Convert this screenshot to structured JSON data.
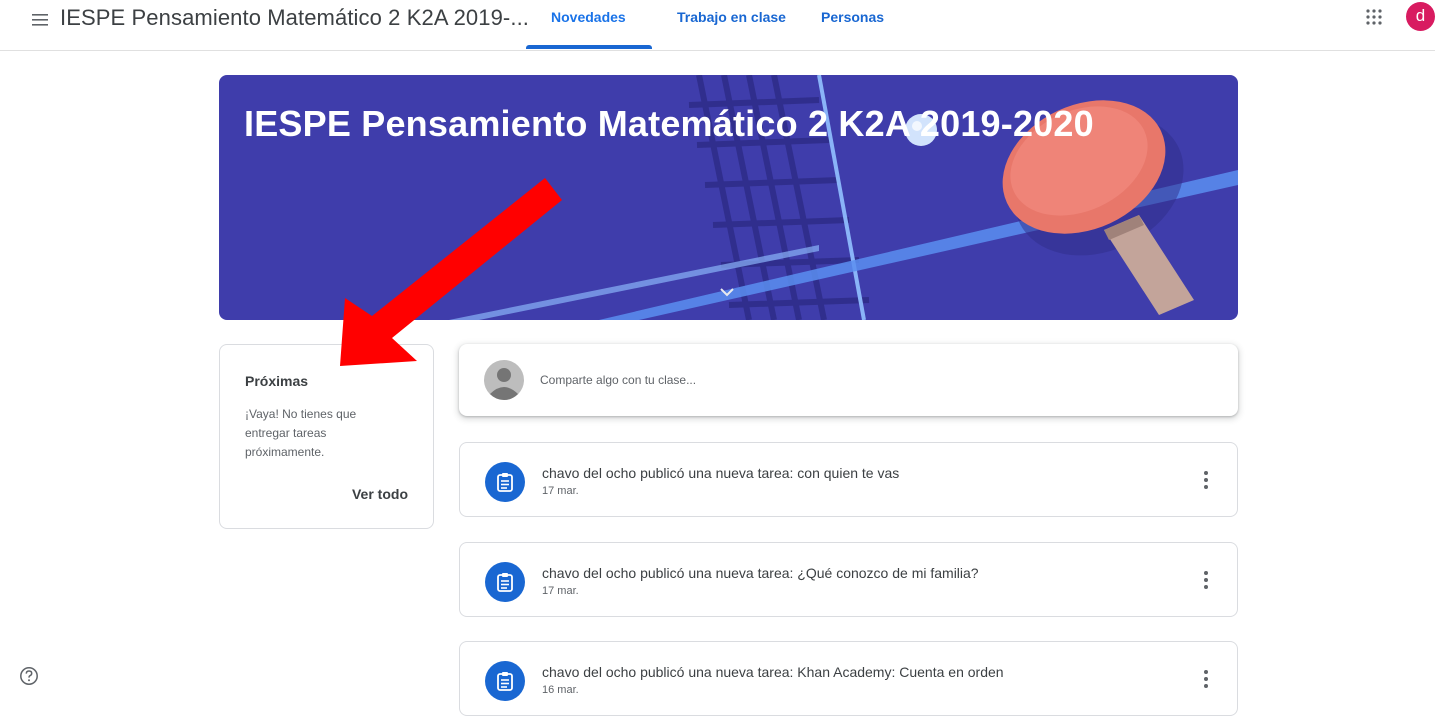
{
  "header": {
    "class_title": "IESPE Pensamiento Matemático 2 K2A 2019-...",
    "tabs": [
      {
        "label": "Novedades",
        "active": true
      },
      {
        "label": "Trabajo en clase",
        "active": false
      },
      {
        "label": "Personas",
        "active": false
      }
    ],
    "avatar_letter": "d",
    "icons": {
      "menu": "hamburger-menu-icon",
      "apps": "apps-grid-icon"
    }
  },
  "banner": {
    "title": "IESPE Pensamiento Matemático 2 K2A 2019-2020",
    "theme": "ping-pong"
  },
  "upcoming": {
    "title": "Próximas",
    "message": "¡Vaya! No tienes que entregar tareas próximamente.",
    "view_all": "Ver todo"
  },
  "share": {
    "placeholder": "Comparte algo con tu clase..."
  },
  "posts": [
    {
      "title": "chavo del ocho publicó una nueva tarea: con quien te vas",
      "date": "17 mar."
    },
    {
      "title": "chavo del ocho publicó una nueva tarea: ¿Qué conozco de mi familia?",
      "date": "17 mar."
    },
    {
      "title": "chavo del ocho publicó una nueva tarea: Khan Academy: Cuenta en orden",
      "date": "16 mar."
    }
  ],
  "colors": {
    "accent": "#1967d2",
    "banner_bg": "#3f3dab",
    "avatar": "#d81b60",
    "annotation_arrow": "#ff0000"
  }
}
